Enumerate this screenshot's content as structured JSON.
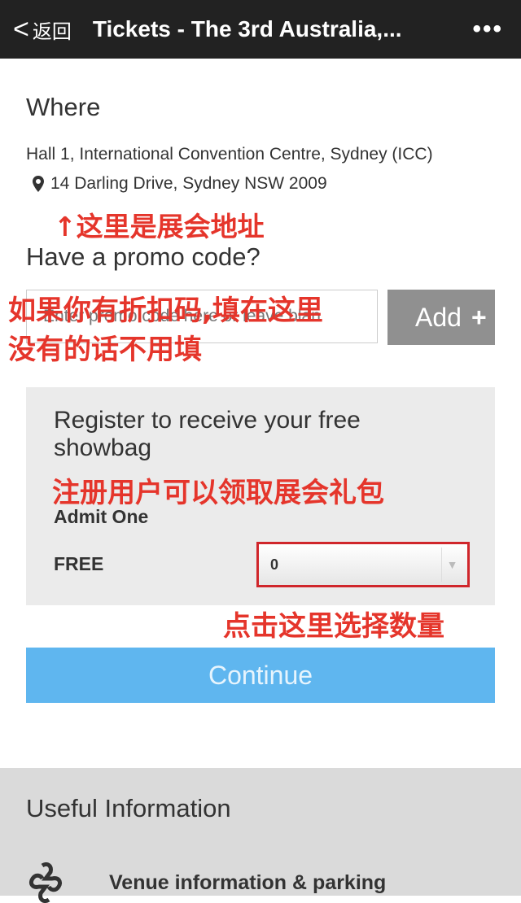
{
  "nav": {
    "back_label": "返回",
    "title": "Tickets - The 3rd Australia,...",
    "more_icon": "ellipsis-icon"
  },
  "where": {
    "heading": "Where",
    "venue": "Hall 1, International Convention Centre, Sydney (ICC)",
    "address": "14 Darling Drive, Sydney NSW 2009",
    "pin_icon": "map-pin-icon"
  },
  "promo": {
    "heading": "Have a promo code?",
    "placeholder": "Enter promo code here or leave blan",
    "add_label": "Add",
    "add_icon": "plus-icon"
  },
  "register": {
    "heading": "Register to receive your free showbag",
    "ticket_name": "Admit One",
    "price": "FREE",
    "quantity": "0"
  },
  "continue_label": "Continue",
  "useful": {
    "heading": "Useful Information",
    "items": [
      {
        "label": "Venue information & parking",
        "icon": "venue-icon"
      }
    ]
  },
  "annotations": {
    "address": "↑这里是展会地址",
    "promo_1": "如果你有折扣码,填在这里",
    "promo_2": "没有的话不用填",
    "showbag": "注册用户可以领取展会礼包",
    "quantity": "点击这里选择数量"
  },
  "colors": {
    "nav_bg": "#222222",
    "continue": "#5fb6ef",
    "annotation": "#e5352b",
    "highlight_border": "#d0262b"
  }
}
